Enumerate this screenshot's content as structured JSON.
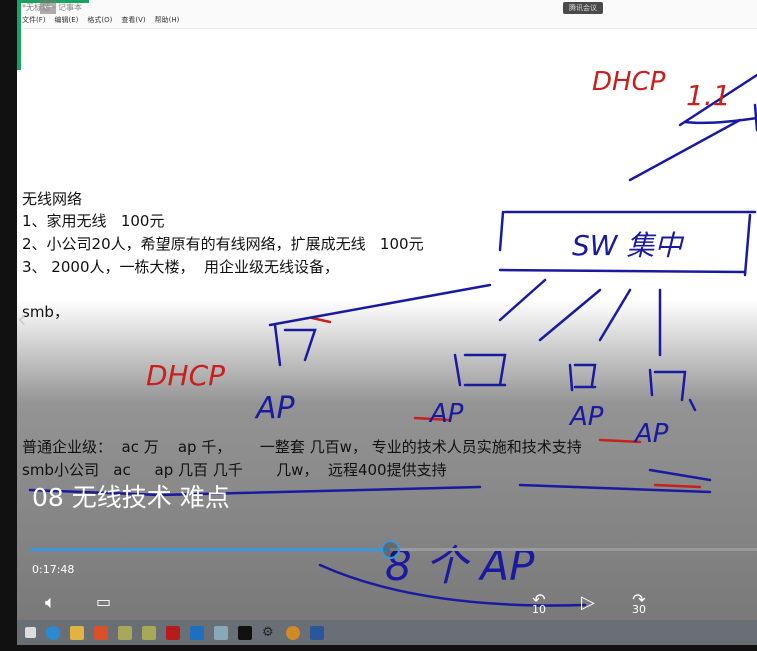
{
  "window": {
    "title": "*无标题 - 记事本",
    "menu": [
      "文件(F)",
      "编辑(E)",
      "格式(O)",
      "查看(V)",
      "帮助(H)"
    ],
    "meeting_badge": "腾讯会议"
  },
  "document": {
    "lines": [
      "无线网络",
      "1、家用无线   100元",
      "2、小公司20人，希望原有的有线网络，扩展成无线   100元",
      "3、 2000人，一栋大楼，  用企业级无线设备，",
      "smb，",
      "普通企业级：  ac 万    ap 千，      一整套 几百w， 专业的技术人员实施和技术支持",
      "smb小公司   ac     ap 几百 几千       几w，  远程400提供支持"
    ]
  },
  "annotations": [
    "DHCP",
    "1.1",
    "SW 集中",
    "DHCP",
    "AP",
    "AP",
    "AP",
    "AP",
    "8 个 AP"
  ],
  "player": {
    "video_title": "08 无线技术 难点",
    "current_time": "0:17:48",
    "progress_percent": 49.5,
    "skip_back": "10",
    "skip_forward": "30"
  },
  "taskbar": {
    "icons": [
      "start-icon",
      "edge-icon",
      "explorer-icon",
      "xmind-icon",
      "app-icon",
      "app-icon",
      "pdf-icon",
      "app-icon",
      "notepad-icon",
      "terminal-icon",
      "settings-icon",
      "search-app-icon",
      "word-icon"
    ]
  }
}
